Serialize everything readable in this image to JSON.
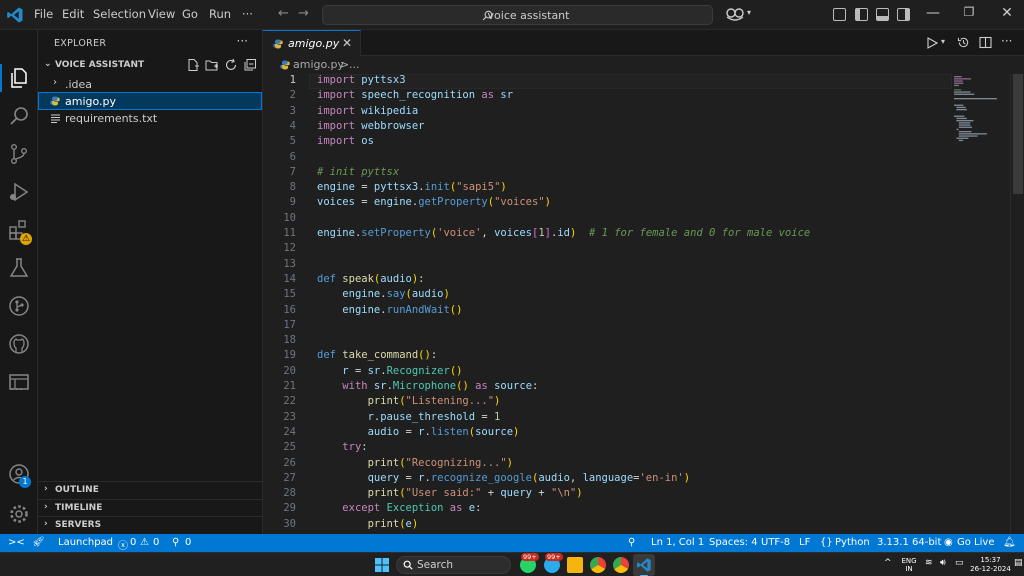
{
  "titlebar": {
    "menu": [
      "File",
      "Edit",
      "Selection",
      "View",
      "Go",
      "Run",
      "···"
    ],
    "search_text": "voice assistant"
  },
  "activitybar": {
    "icons": [
      "explorer-icon",
      "search-icon",
      "source-control-icon",
      "run-debug-icon",
      "extensions-icon",
      "testing-icon",
      "git-graph-icon",
      "github-icon",
      "remote-explorer-icon",
      "more-icon",
      "accounts-icon",
      "manage-icon"
    ],
    "accounts_badge": "1"
  },
  "sidebar": {
    "title": "EXPLORER",
    "more": "···",
    "folder": "VOICE ASSISTANT",
    "tree": [
      {
        "label": ".idea",
        "type": "folder"
      },
      {
        "label": "amigo.py",
        "type": "python-file",
        "selected": true
      },
      {
        "label": "requirements.txt",
        "type": "text-file"
      }
    ],
    "sections": [
      "OUTLINE",
      "TIMELINE",
      "SERVERS"
    ]
  },
  "editor": {
    "tab_label": "amigo.py",
    "breadcrumb_file": "amigo.py",
    "breadcrumb_sep": ">",
    "breadcrumb_more": "...",
    "active_line": 1,
    "line_numbers": [
      "1",
      "2",
      "3",
      "4",
      "5",
      "6",
      "7",
      "8",
      "9",
      "10",
      "11",
      "12",
      "13",
      "14",
      "15",
      "16",
      "17",
      "18",
      "19",
      "20",
      "21",
      "22",
      "23",
      "24",
      "25",
      "26",
      "27",
      "28",
      "29",
      "30"
    ],
    "code": [
      "import pyttsx3",
      "import speech_recognition as sr",
      "import wikipedia",
      "import webbrowser",
      "import os",
      "",
      "# init pyttsx",
      "engine = pyttsx3.init(\"sapi5\")",
      "voices = engine.getProperty(\"voices\")",
      "",
      "engine.setProperty('voice', voices[1].id)  # 1 for female and 0 for male voice",
      "",
      "",
      "def speak(audio):",
      "    engine.say(audio)",
      "    engine.runAndWait()",
      "",
      "",
      "def take_command():",
      "    r = sr.Recognizer()",
      "    with sr.Microphone() as source:",
      "        print(\"Listening...\")",
      "        r.pause_threshold = 1",
      "        audio = r.listen(source)",
      "    try:",
      "        print(\"Recognizing...\")",
      "        query = r.recognize_google(audio, language='en-in')",
      "        print(\"User said:\" + query + \"\\n\")",
      "    except Exception as e:",
      "        print(e)"
    ]
  },
  "statusbar": {
    "remote": "><",
    "launchpad": "Launchpad",
    "errors": "0",
    "warnings": "0",
    "ports": "0",
    "position": "Ln 1, Col 1",
    "spaces": "Spaces: 4",
    "encoding": "UTF-8",
    "eol": "LF",
    "language": "Python",
    "interpreter": "3.13.1 64-bit",
    "golive": "Go Live",
    "colors": {
      "background": "#0078d4"
    }
  },
  "taskbar": {
    "search_label": "Search",
    "badge1": "99+",
    "badge2": "99+",
    "lang_top": "ENG",
    "lang_bottom": "IN",
    "time": "15:37",
    "date": "26-12-2024"
  }
}
